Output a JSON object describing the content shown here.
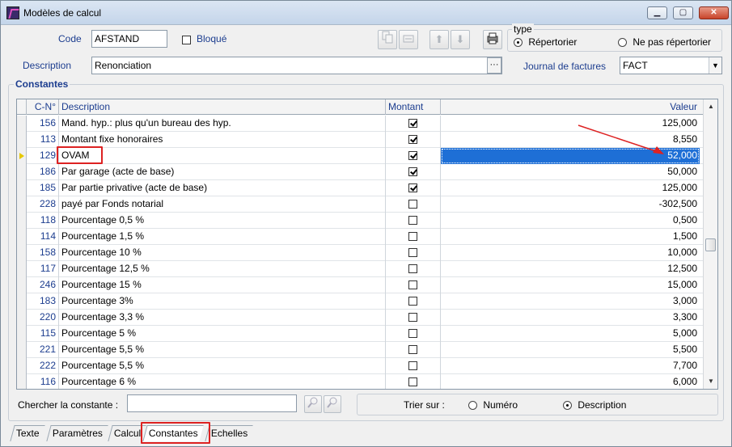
{
  "window": {
    "title": "Modèles de calcul",
    "min": "▁",
    "max": "▢",
    "close": "✕"
  },
  "form": {
    "code_label": "Code",
    "code_value": "AFSTAND",
    "bloque_label": "Bloqué",
    "description_label": "Description",
    "description_value": "Renonciation",
    "dots": "···",
    "type_label": "type",
    "type_options": [
      "Répertorier",
      "Ne pas répertorier"
    ],
    "journal_label": "Journal de factures",
    "journal_value": "FACT"
  },
  "constantes": {
    "label": "Constantes",
    "headers": {
      "num": "C-N°",
      "desc": "Description",
      "montant": "Montant",
      "valeur": "Valeur"
    },
    "rows": [
      {
        "num": "156",
        "desc": "Mand. hyp.: plus qu'un bureau des hyp.",
        "montant": true,
        "valeur": "125,000"
      },
      {
        "num": "113",
        "desc": "Montant fixe honoraires",
        "montant": true,
        "valeur": "8,550"
      },
      {
        "num": "129",
        "desc": "OVAM",
        "montant": true,
        "valeur": "52,000",
        "selected": true
      },
      {
        "num": "186",
        "desc": "Par garage (acte de base)",
        "montant": true,
        "valeur": "50,000"
      },
      {
        "num": "185",
        "desc": "Par partie privative (acte de base)",
        "montant": true,
        "valeur": "125,000"
      },
      {
        "num": "228",
        "desc": "payé par Fonds notarial",
        "montant": false,
        "valeur": "-302,500"
      },
      {
        "num": "118",
        "desc": "Pourcentage 0,5 %",
        "montant": false,
        "valeur": "0,500"
      },
      {
        "num": "114",
        "desc": "Pourcentage 1,5 %",
        "montant": false,
        "valeur": "1,500"
      },
      {
        "num": "158",
        "desc": "Pourcentage 10 %",
        "montant": false,
        "valeur": "10,000"
      },
      {
        "num": "117",
        "desc": "Pourcentage 12,5 %",
        "montant": false,
        "valeur": "12,500"
      },
      {
        "num": "246",
        "desc": "Pourcentage 15 %",
        "montant": false,
        "valeur": "15,000"
      },
      {
        "num": "183",
        "desc": "Pourcentage 3%",
        "montant": false,
        "valeur": "3,000"
      },
      {
        "num": "220",
        "desc": "Pourcentage 3,3 %",
        "montant": false,
        "valeur": "3,300"
      },
      {
        "num": "115",
        "desc": "Pourcentage 5 %",
        "montant": false,
        "valeur": "5,000"
      },
      {
        "num": "221",
        "desc": "Pourcentage 5,5 %",
        "montant": false,
        "valeur": "5,500"
      },
      {
        "num": "222",
        "desc": "Pourcentage 5,5 %",
        "montant": false,
        "valeur": "7,700"
      },
      {
        "num": "116",
        "desc": "Pourcentage 6 %",
        "montant": false,
        "valeur": "6,000"
      }
    ]
  },
  "search": {
    "label": "Chercher la constante :",
    "value": "",
    "sort_label": "Trier sur :",
    "sort_options": [
      "Numéro",
      "Description"
    ],
    "sort_selected": "Description"
  },
  "tabs": [
    "Texte",
    "Paramètres",
    "Calcul",
    "Constantes",
    "Echelles"
  ],
  "active_tab": "Constantes",
  "colors": {
    "accent": "#1e6fd6",
    "label": "#1c3d8f",
    "highlight_box": "#dd2222"
  }
}
